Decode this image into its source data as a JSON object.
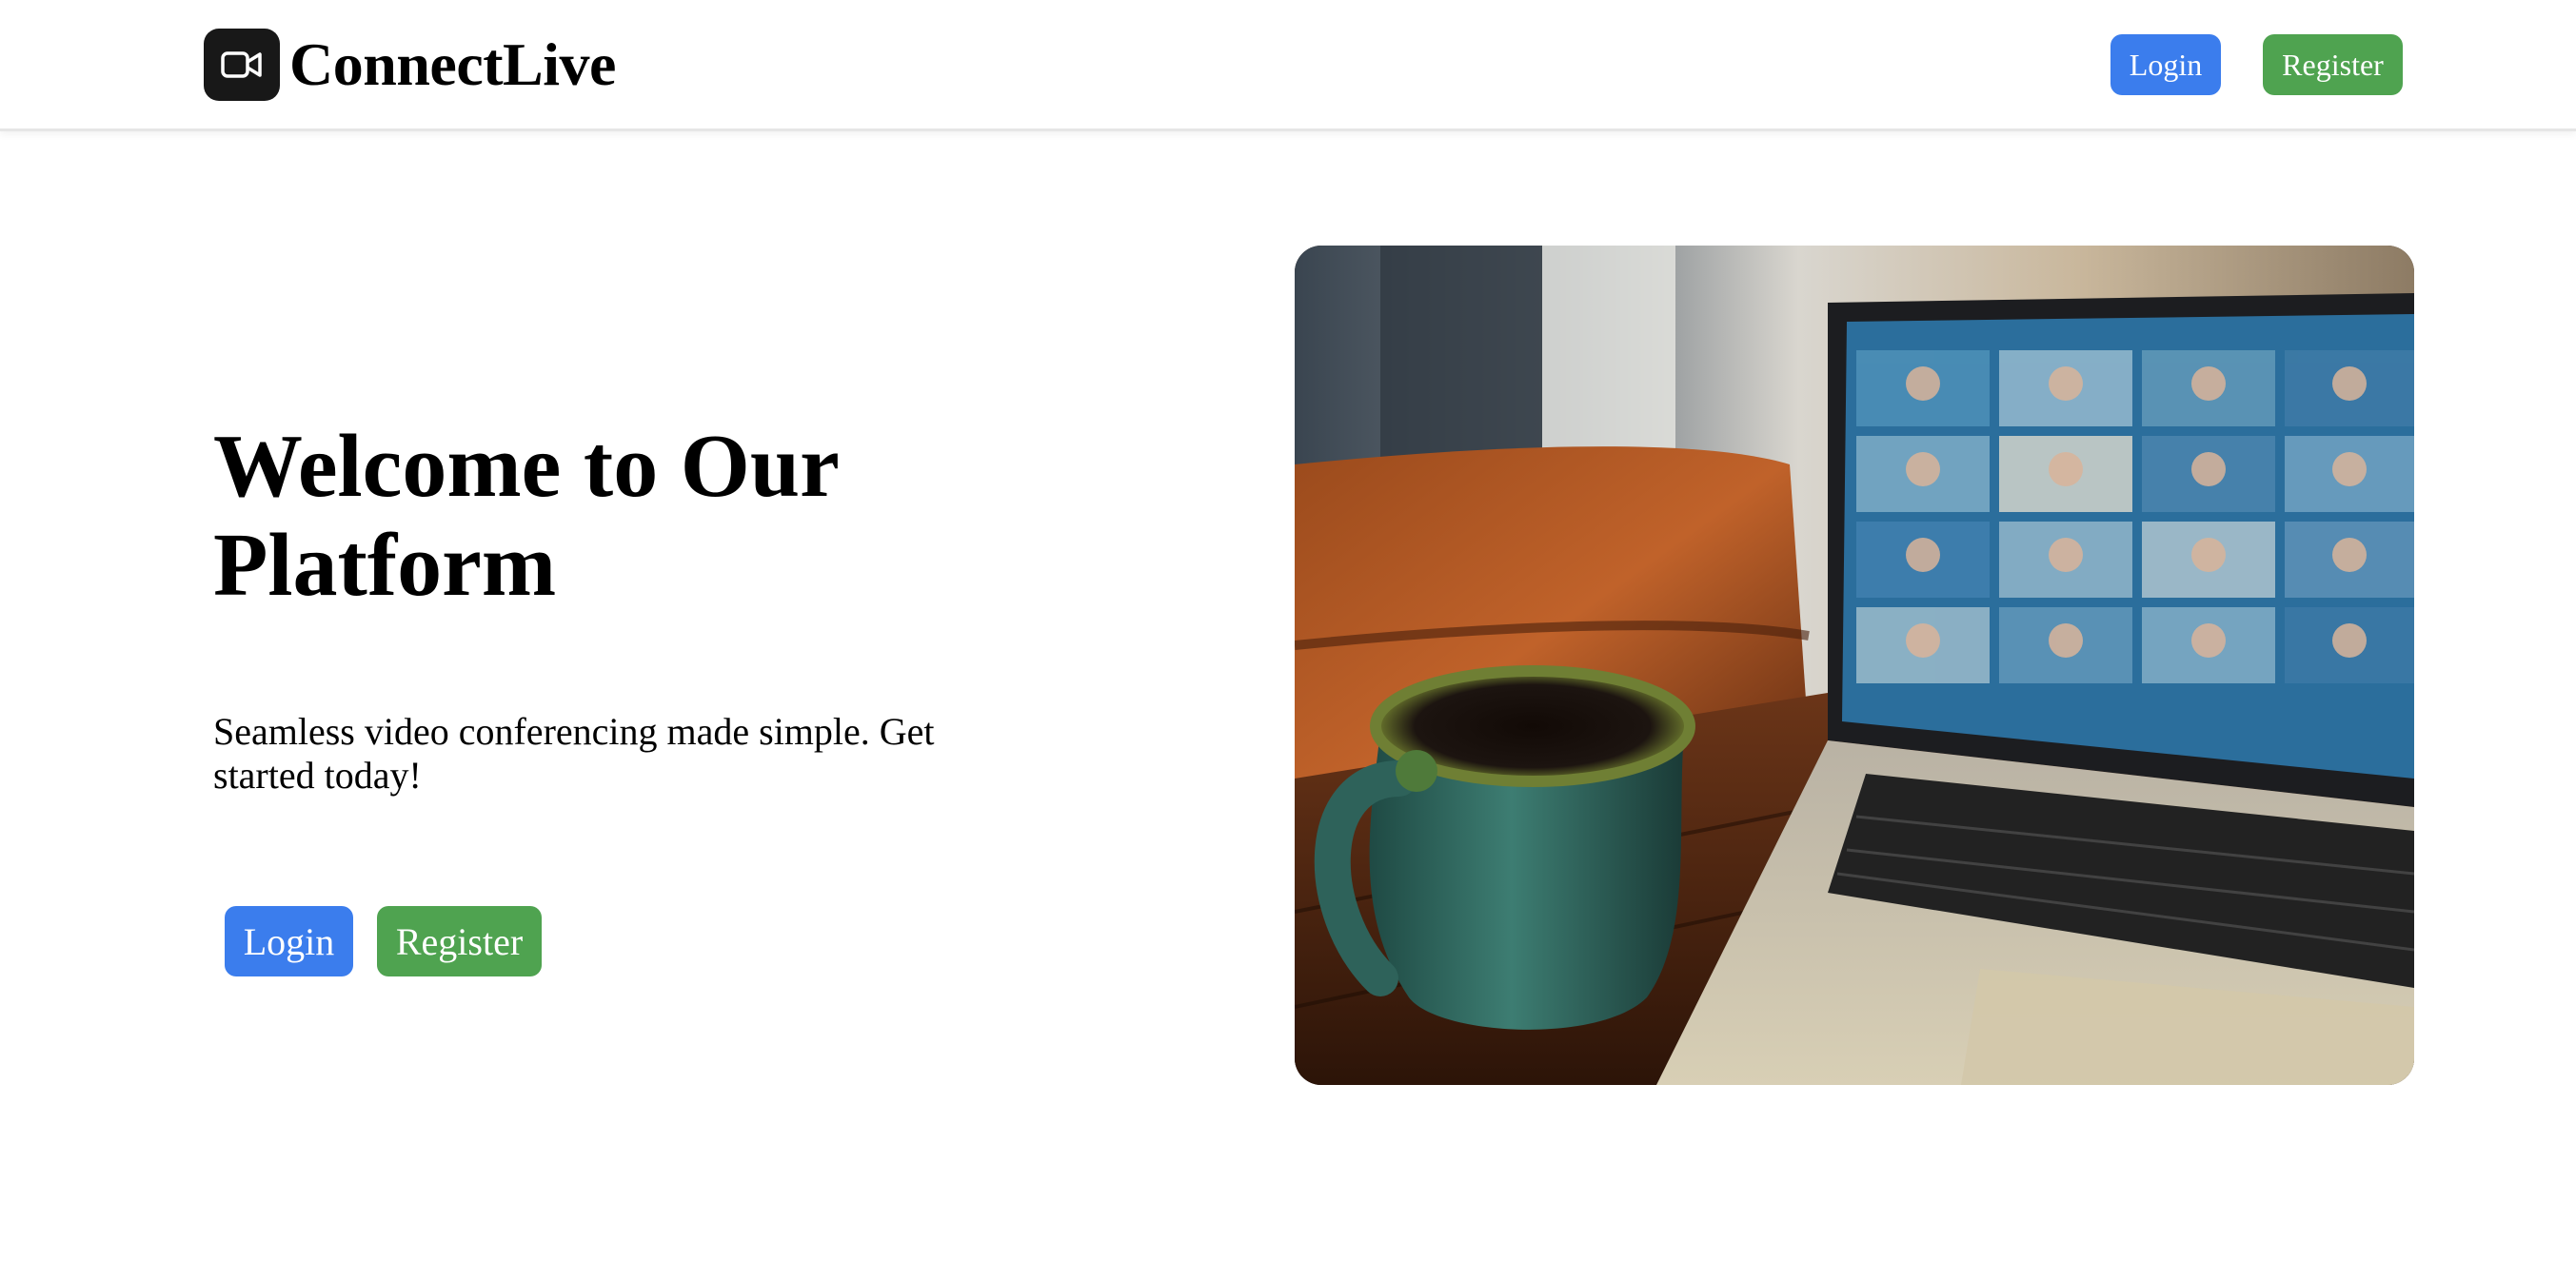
{
  "header": {
    "brand_name": "ConnectLive",
    "logo_icon": "video-camera-icon",
    "login_label": "Login",
    "register_label": "Register"
  },
  "hero": {
    "title": "Welcome to Our Platform",
    "subtitle": "Seamless video conferencing made simple. Get started today!",
    "login_label": "Login",
    "register_label": "Register",
    "image_alt": "Laptop showing a video call grid next to a green ceramic mug on a wooden table"
  },
  "colors": {
    "login_button": "#3b7ded",
    "register_button": "#4fa350",
    "logo_background": "#181818",
    "page_background": "#ffffff"
  }
}
